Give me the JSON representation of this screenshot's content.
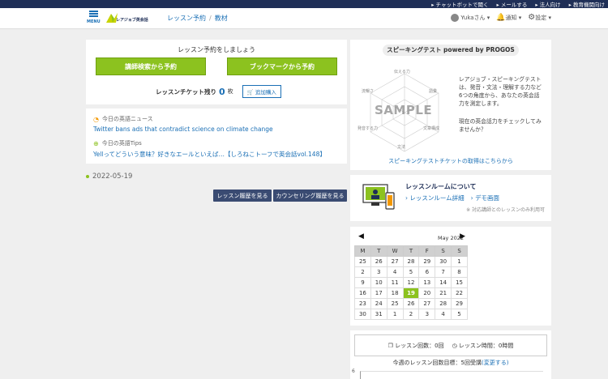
{
  "topbar": {
    "links": [
      "チャットボットで聞く",
      "メールする",
      "法人向け",
      "教育機関向け"
    ]
  },
  "header": {
    "menu_label": "MENU",
    "logo_text": "レアジョブ英会話",
    "nav": [
      "レッスン予約",
      "教材"
    ],
    "user_label": "Yukaさん",
    "notify_label": "通知",
    "settings_label": "設定"
  },
  "reserve": {
    "title": "レッスン予約をしましょう",
    "btn_teacher": "講師検索から予約",
    "btn_bookmark": "ブックマークから予約",
    "ticket_label": "レッスンチケット残り",
    "ticket_count": "0",
    "ticket_unit": "枚",
    "add_label": "追加購入"
  },
  "news": {
    "news_label": "今日の英語ニュース",
    "news_link": "Twitter bans ads that contradict science on climate change",
    "tips_label": "今日の英語Tips",
    "tips_link": "Yellってどういう意味？好きなエールといえば…【しろねこトーフで英会話vol.148】"
  },
  "history": {
    "date": "2022-05-19",
    "btn_lesson": "レッスン履歴を見る",
    "btn_counseling": "カウンセリング履歴を見る"
  },
  "speaking": {
    "title": "スピーキングテスト powered by PROGOS",
    "radar_labels": [
      "伝える力",
      "語彙",
      "文章構成",
      "文法",
      "発音する力",
      "流暢さ"
    ],
    "sample": "SAMPLE",
    "desc1": "レアジョブ・スピーキングテストは、発音・文法・理解する力など6つの角度から、あなたの英会話力を測定します。",
    "desc2": "現在の英会話力をチェックしてみませんか？",
    "link": "スピーキングテストチケットの取得はこちらから"
  },
  "lesson_room": {
    "title": "レッスンルームについて",
    "link1": "レッスンルーム詳細",
    "link2": "デモ画面",
    "note": "※ 対応講師とのレッスンのみ利用可"
  },
  "calendar": {
    "month": "May 2022",
    "weekdays": [
      "M",
      "T",
      "W",
      "T",
      "F",
      "S",
      "S"
    ],
    "weeks": [
      [
        "25",
        "26",
        "27",
        "28",
        "29",
        "30",
        "1"
      ],
      [
        "2",
        "3",
        "4",
        "5",
        "6",
        "7",
        "8"
      ],
      [
        "9",
        "10",
        "11",
        "12",
        "13",
        "14",
        "15"
      ],
      [
        "16",
        "17",
        "18",
        "19",
        "20",
        "21",
        "22"
      ],
      [
        "23",
        "24",
        "25",
        "26",
        "27",
        "28",
        "29"
      ],
      [
        "30",
        "31",
        "1",
        "2",
        "3",
        "4",
        "5"
      ]
    ],
    "today": "19"
  },
  "stats": {
    "lesson_count": "レッスン回数：0回",
    "lesson_time": "レッスン時間：0時間",
    "goal_prefix": "今週のレッスン回数目標：",
    "goal_value": "5回受講",
    "goal_change": "(変更する)",
    "y_tick": "6"
  },
  "colors": {
    "green": "#8cc21f",
    "navy": "#1f2f57",
    "link": "#1a6fb5"
  }
}
